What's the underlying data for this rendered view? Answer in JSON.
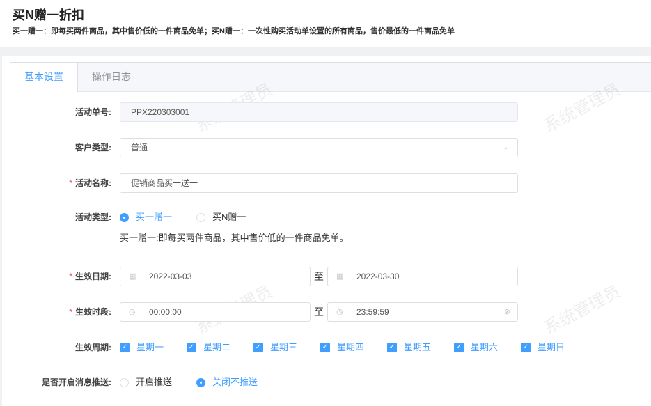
{
  "header": {
    "title": "买N赠一折扣",
    "desc": "买一赠一：即每买两件商品，其中售价低的一件商品免单；买N赠一：一次性购买活动单设置的所有商品，售价最低的一件商品免单"
  },
  "tabs": [
    {
      "label": "基本设置",
      "active": true
    },
    {
      "label": "操作日志",
      "active": false
    }
  ],
  "watermark": "系统管理员",
  "form": {
    "order_no": {
      "label": "活动单号:",
      "value": "PPX220303001"
    },
    "customer_type": {
      "label": "客户类型:",
      "value": "普通"
    },
    "name": {
      "label": "活动名称:",
      "value": "促销商品买一送一"
    },
    "type": {
      "label": "活动类型:",
      "options": [
        "买一赠一",
        "买N赠一"
      ],
      "selected": "买一赠一",
      "hint": "买一赠一:即每买两件商品，其中售价低的一件商品免单。"
    },
    "date": {
      "label": "生效日期:",
      "start": "2022-03-03",
      "end": "2022-03-30",
      "sep": "至"
    },
    "time": {
      "label": "生效时段:",
      "start": "00:00:00",
      "end": "23:59:59",
      "sep": "至"
    },
    "weekdays": {
      "label": "生效周期:",
      "items": [
        "星期一",
        "星期二",
        "星期三",
        "星期四",
        "星期五",
        "星期六",
        "星期日"
      ]
    },
    "push": {
      "label": "是否开启消息推送:",
      "options": [
        "开启推送",
        "关闭不推送"
      ],
      "selected": "关闭不推送"
    }
  },
  "required_mark": "*"
}
